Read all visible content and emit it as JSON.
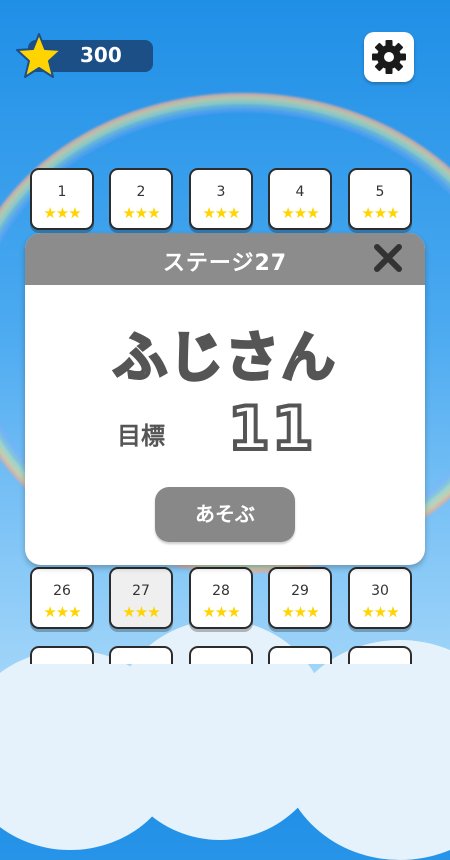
{
  "hud": {
    "score": "300",
    "star_icon": "star-icon",
    "settings_icon": "gear-icon"
  },
  "stages_top": [
    {
      "num": "1",
      "stars": "★★★"
    },
    {
      "num": "2",
      "stars": "★★★"
    },
    {
      "num": "3",
      "stars": "★★★"
    },
    {
      "num": "4",
      "stars": "★★★"
    },
    {
      "num": "5",
      "stars": "★★★"
    }
  ],
  "stages_bottom": [
    {
      "num": "26",
      "stars": "★★★"
    },
    {
      "num": "27",
      "stars": "★★★"
    },
    {
      "num": "28",
      "stars": "★★★"
    },
    {
      "num": "29",
      "stars": "★★★"
    },
    {
      "num": "30",
      "stars": "★★★"
    }
  ],
  "modal": {
    "title": "ステージ27",
    "stage_name": "ふじさん",
    "goal_label": "目標",
    "goal_value": "11",
    "play_label": "あそぶ",
    "close_icon": "close-icon"
  },
  "colors": {
    "star": "#ffd400",
    "header": "#8c8c8c",
    "button": "#888888",
    "score_pill": "#1b4f86"
  }
}
